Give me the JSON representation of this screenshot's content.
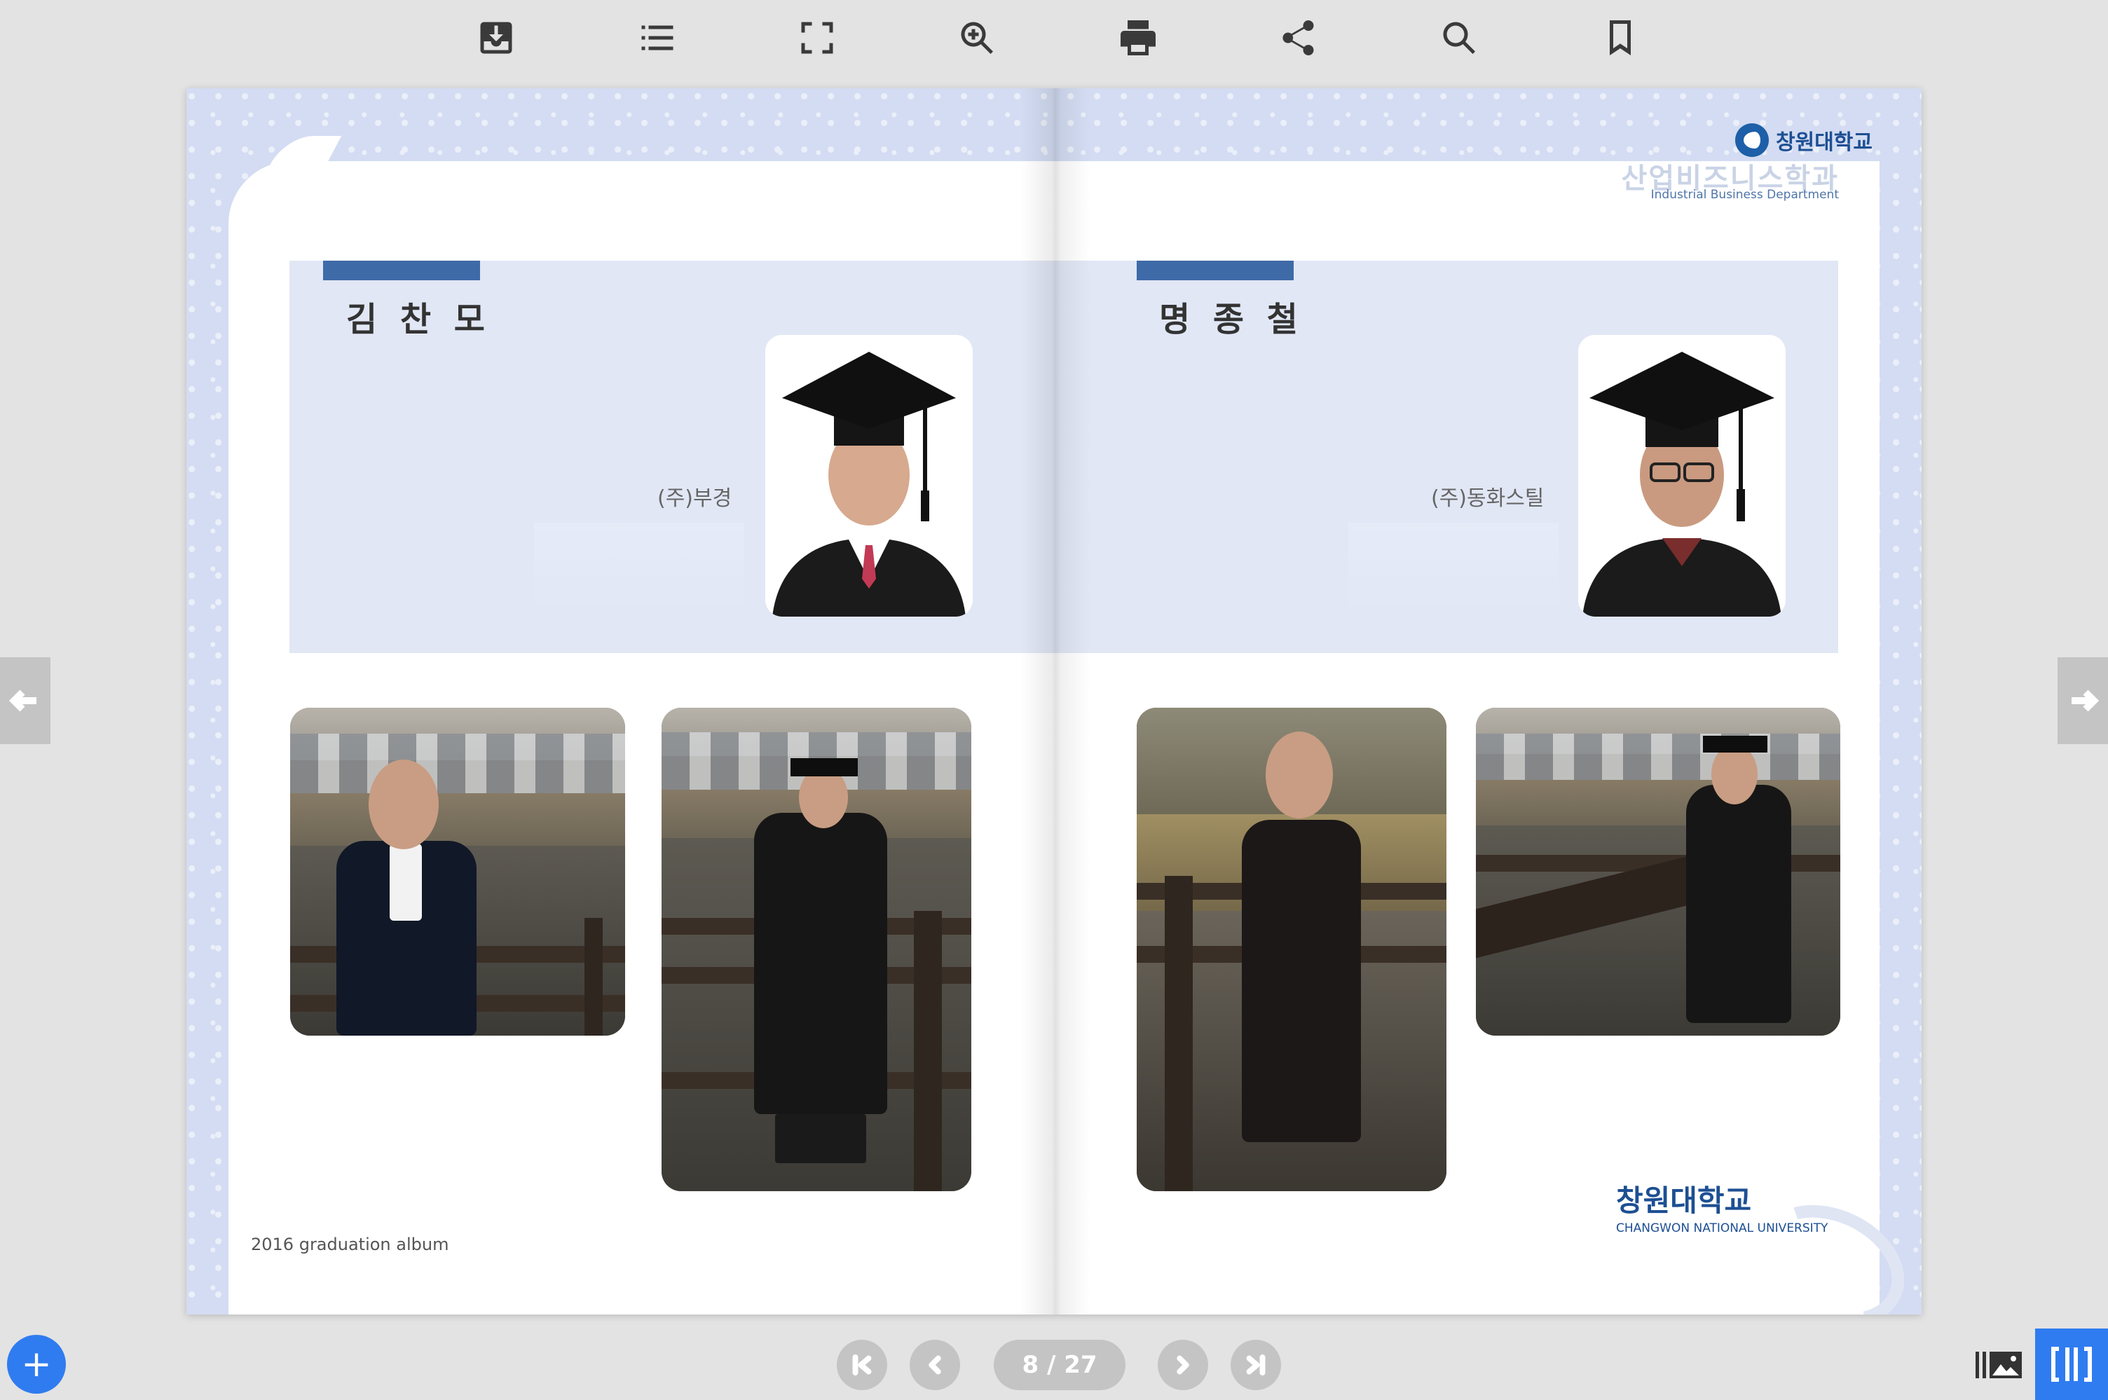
{
  "toolbar": {
    "icons": [
      "download-icon",
      "toc-icon",
      "fullscreen-icon",
      "zoom-in-icon",
      "print-icon",
      "share-icon",
      "search-icon",
      "bookmark-icon"
    ]
  },
  "book": {
    "university_name_top": "창원대학교",
    "department_ko": "산업비즈니스학과",
    "department_en": "Industrial Business Department",
    "left_person": {
      "name": "김 찬 모",
      "company": "(주)부경"
    },
    "right_person": {
      "name": "명 종 철",
      "company": "(주)동화스틸"
    },
    "footer_text": "2016 graduation album",
    "university_name_bottom": "창원대학교",
    "university_name_bottom_en": "CHANGWON NATIONAL UNIVERSITY"
  },
  "pagination": {
    "current": "8 / 27"
  },
  "colors": {
    "accent": "#2f7cf0",
    "name_bar": "#3f6aa8",
    "panel": "#e1e7f5",
    "university_blue": "#1d4f93"
  }
}
